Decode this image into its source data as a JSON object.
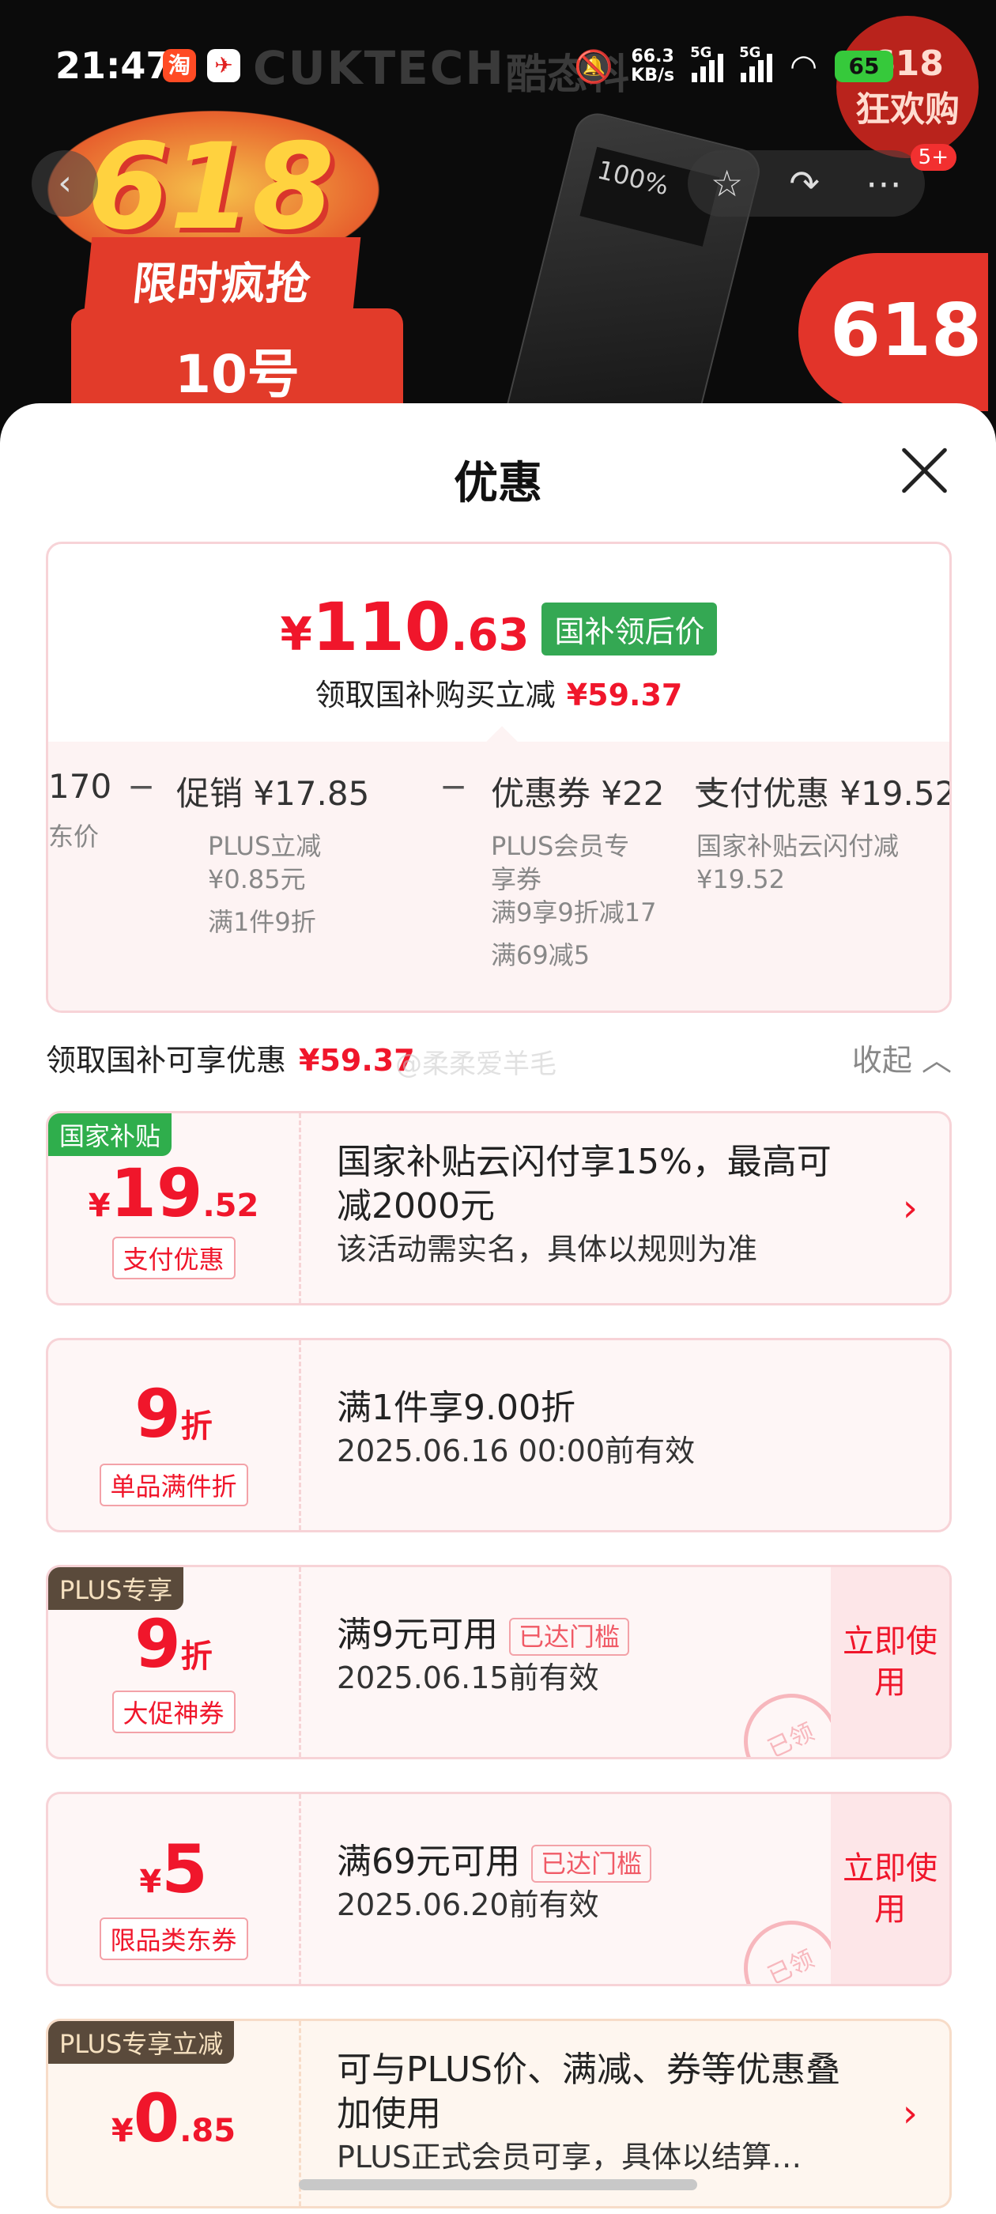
{
  "status_bar": {
    "time": "21:47",
    "app_icons": [
      "淘",
      "✈"
    ],
    "net_speed": "66.3",
    "net_unit": "KB/s",
    "sig1": "5G",
    "sig2": "5G",
    "battery": "65"
  },
  "background": {
    "brand": "CUKTECH",
    "brand_cn": "酷态科",
    "promo_num": "618",
    "promo_slogan": "限时疯抢",
    "promo_tag": "10号",
    "badge_618": "618",
    "badge_top_line1": "618",
    "badge_top_line2": "狂欢购",
    "nav_badge": "5+"
  },
  "sheet": {
    "title": "优惠",
    "price_card": {
      "currency": "¥",
      "price_int": "110",
      "price_dec": ".63",
      "tag": "国补领后价",
      "sub_text": "领取国补购买立减",
      "sub_amount": "¥59.37",
      "calc": [
        {
          "head": "170",
          "sub": [
            "东价"
          ]
        },
        {
          "head": "促销 ¥17.85",
          "sub": [
            "PLUS立减",
            "¥0.85元",
            "满1件9折"
          ]
        },
        {
          "head": "优惠券 ¥22",
          "sub": [
            "PLUS会员专",
            "享券",
            "满9享9折减17",
            "满69减5"
          ]
        },
        {
          "head": "支付优惠 ¥19.52",
          "sub": [
            "国家补贴云闪付减",
            "¥19.52"
          ]
        }
      ],
      "minus": "−"
    },
    "section": {
      "title": "领取国补可享优惠",
      "amount": "¥59.37",
      "collapse": "收起",
      "watermark": "@柔柔爱羊毛"
    },
    "coupons": [
      {
        "corner": "国家补贴",
        "yen": "¥",
        "big": "19",
        "small": ".52",
        "label": "支付优惠",
        "title": "国家补贴云闪付享15%，最高可减2000元",
        "desc": "该活动需实名，具体以规则为准"
      },
      {
        "big": "9",
        "unit": "折",
        "label": "单品满件折",
        "title": "满1件享9.00折",
        "desc": "2025.06.16 00:00前有效"
      },
      {
        "corner": "PLUS专享",
        "big": "9",
        "unit": "折",
        "label": "大促神券",
        "title": "满9元可用",
        "threshold": "已达门槛",
        "desc": "2025.06.15前有效",
        "button": "立即使用",
        "stamp": "已领"
      },
      {
        "yen": "¥",
        "big": "5",
        "label": "限品类东券",
        "title": "满69元可用",
        "threshold": "已达门槛",
        "desc": "2025.06.20前有效",
        "button": "立即使用",
        "stamp": "已领"
      },
      {
        "corner": "PLUS专享立减",
        "yen": "¥",
        "big": "0",
        "small": ".85",
        "title": "可与PLUS价、满减、券等优惠叠加使用",
        "desc": "PLUS正式会员可享，具体以结算…"
      }
    ]
  },
  "colors": {
    "accent_red": "#f0162b",
    "tag_green": "#34a853",
    "card_pink": "#fef6f6",
    "plus_brown": "#5a4a3b"
  }
}
